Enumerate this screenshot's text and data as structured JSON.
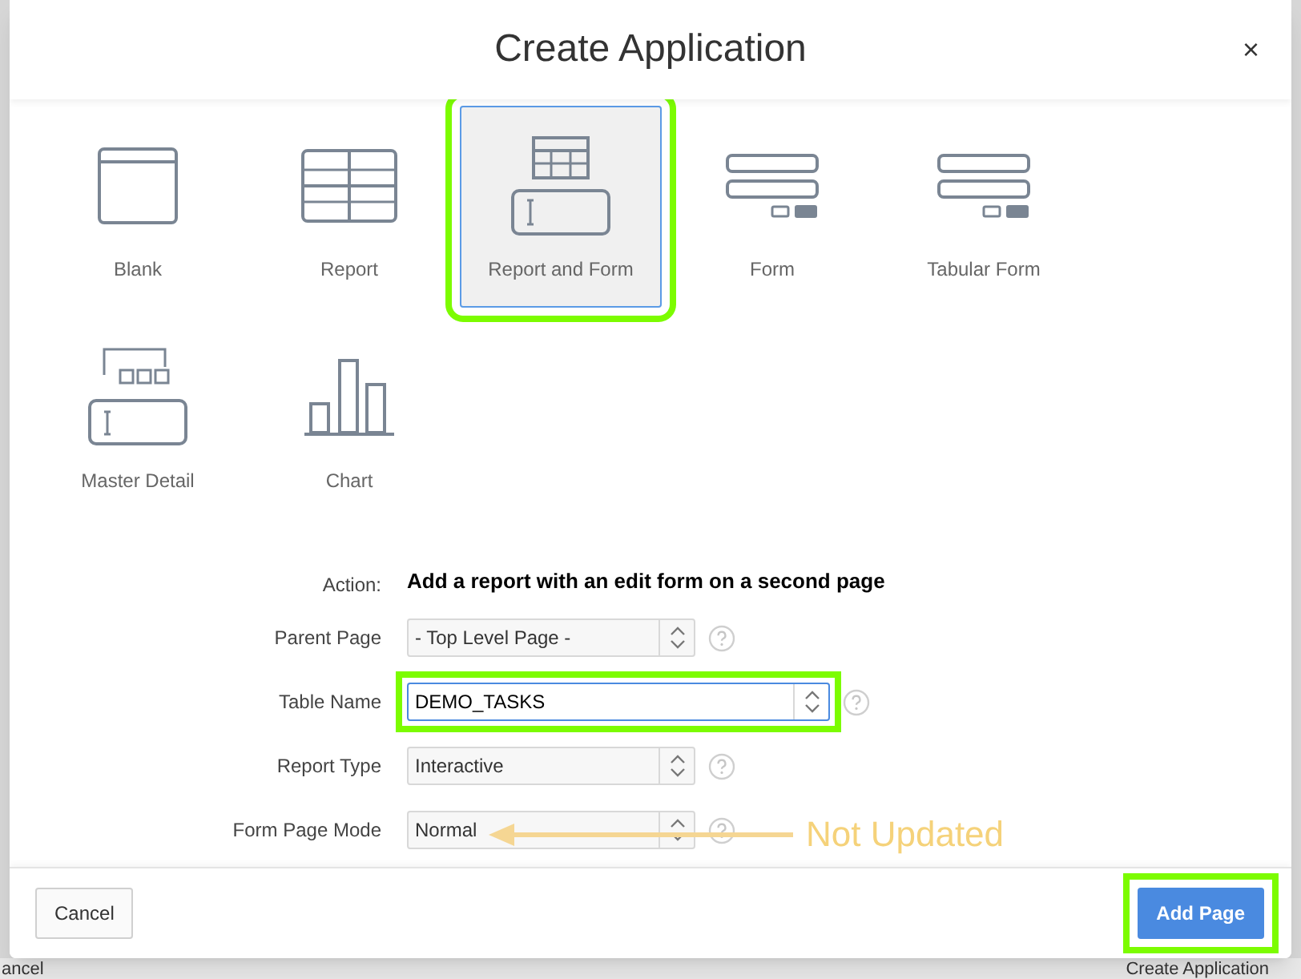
{
  "backdrop": {
    "left_button": "ancel",
    "right_button": "Create Application"
  },
  "dialog": {
    "title": "Create Application",
    "close": "×"
  },
  "page_types": [
    {
      "label": "Blank",
      "selected": false,
      "highlighted": false
    },
    {
      "label": "Report",
      "selected": false,
      "highlighted": false
    },
    {
      "label": "Report and Form",
      "selected": true,
      "highlighted": true
    },
    {
      "label": "Form",
      "selected": false,
      "highlighted": false
    },
    {
      "label": "Tabular Form",
      "selected": false,
      "highlighted": false
    },
    {
      "label": "Master Detail",
      "selected": false,
      "highlighted": false
    },
    {
      "label": "Chart",
      "selected": false,
      "highlighted": false
    }
  ],
  "action": {
    "label": "Action:",
    "value": "Add a report with an edit form on a second page"
  },
  "fields": [
    {
      "label": "Parent Page",
      "value": "- Top Level Page -",
      "focused": false,
      "highlighted": false,
      "wide": false
    },
    {
      "label": "Table Name",
      "value": "DEMO_TASKS",
      "focused": true,
      "highlighted": true,
      "wide": true
    },
    {
      "label": "Report Type",
      "value": "Interactive",
      "focused": false,
      "highlighted": false,
      "wide": false
    },
    {
      "label": "Form Page Mode",
      "value": "Normal",
      "focused": false,
      "highlighted": false,
      "wide": false
    }
  ],
  "annotation": {
    "text": "Not Updated"
  },
  "footer": {
    "cancel": "Cancel",
    "submit": {
      "label": "Add Page",
      "highlighted": true
    }
  }
}
